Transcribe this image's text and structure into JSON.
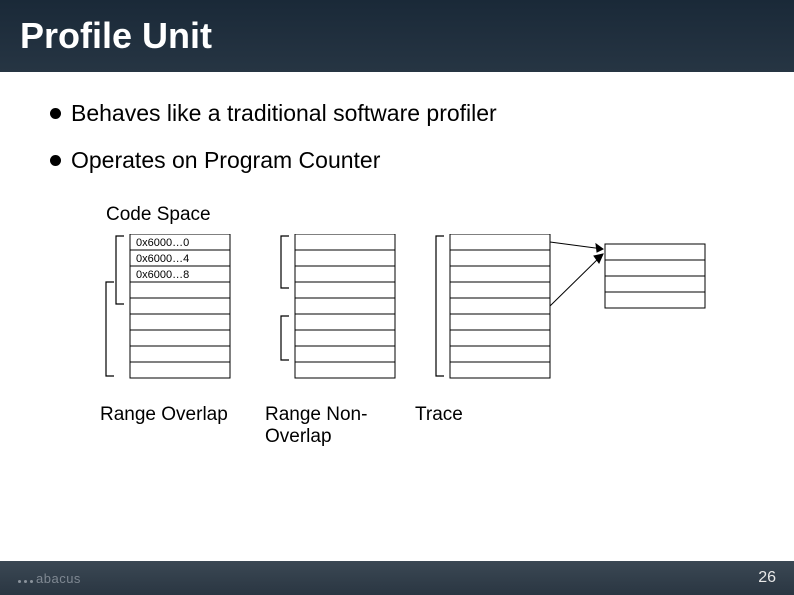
{
  "header": {
    "title": "Profile Unit"
  },
  "bullets": [
    "Behaves like a traditional software profiler",
    "Operates on Program Counter"
  ],
  "diagram": {
    "code_space_label": "Code Space",
    "addresses": [
      "0x6000…0",
      "0x6000…4",
      "0x6000…8"
    ],
    "captions": {
      "col1": "Range Overlap",
      "col2": "Range Non-Overlap",
      "col3": "Trace"
    }
  },
  "footer": {
    "logo_text": "abacus",
    "page_number": "26"
  }
}
